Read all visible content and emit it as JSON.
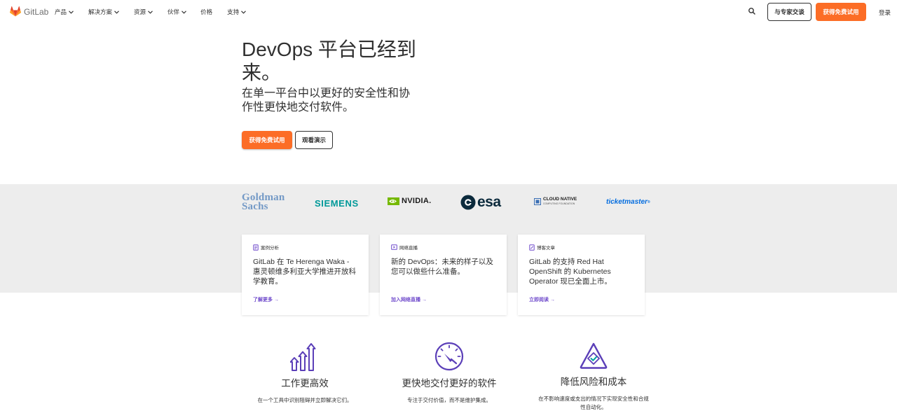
{
  "nav": {
    "logo_text": "GitLab",
    "items": [
      {
        "label": "产品",
        "has_menu": true
      },
      {
        "label": "解决方案",
        "has_menu": true
      },
      {
        "label": "资源",
        "has_menu": true
      },
      {
        "label": "伙伴",
        "has_menu": true
      },
      {
        "label": "价格",
        "has_menu": false
      },
      {
        "label": "支持",
        "has_menu": true
      }
    ],
    "contact_label": "与专家交谈",
    "trial_label": "获得免费试用",
    "login_label": "登录"
  },
  "hero": {
    "title": "DevOps 平台已经到来。",
    "subtitle": "在单一平台中以更好的安全性和协作性更快地交付软件。",
    "primary_label": "获得免费试用",
    "secondary_label": "观看演示"
  },
  "customers": {
    "goldman_line1": "Goldman",
    "goldman_line2": "Sachs",
    "siemens": "SIEMENS",
    "nvidia": "NVIDIA.",
    "esa": "esa",
    "cncf_line1": "CLOUD NATIVE",
    "cncf_line2": "COMPUTING FOUNDATION",
    "ticketmaster": "ticketmaster"
  },
  "cards": [
    {
      "tag": "案例分析",
      "title": "GitLab 在 Te Herenga Waka - 惠灵顿维多利亚大学推进开放科学教育。",
      "link": "了解更多 →"
    },
    {
      "tag": "网络直播",
      "title": "新的 DevOps：未来的样子以及您可以做些什么准备。",
      "link": "加入网络直播 →"
    },
    {
      "tag": "博客文章",
      "title": "GitLab 的支持 Red Hat OpenShift 的 Kubernetes Operator 现已全面上市。",
      "link": "立即阅读 →"
    }
  ],
  "features": [
    {
      "title": "工作更高效",
      "desc": "在一个工具中识别阻碍并立即解决它们。"
    },
    {
      "title": "更快地交付更好的软件",
      "desc": "专注于交付价值，而不是维护集成。"
    },
    {
      "title": "降低风险和成本",
      "desc": "在不影响速度或支出的情况下实现安全性和合规性自动化。"
    }
  ],
  "colors": {
    "accent": "#fc6d26",
    "link_purple": "#6e49cb",
    "icon_purple": "#5b3fb8",
    "band_gray": "#ededed",
    "text": "#303030"
  }
}
